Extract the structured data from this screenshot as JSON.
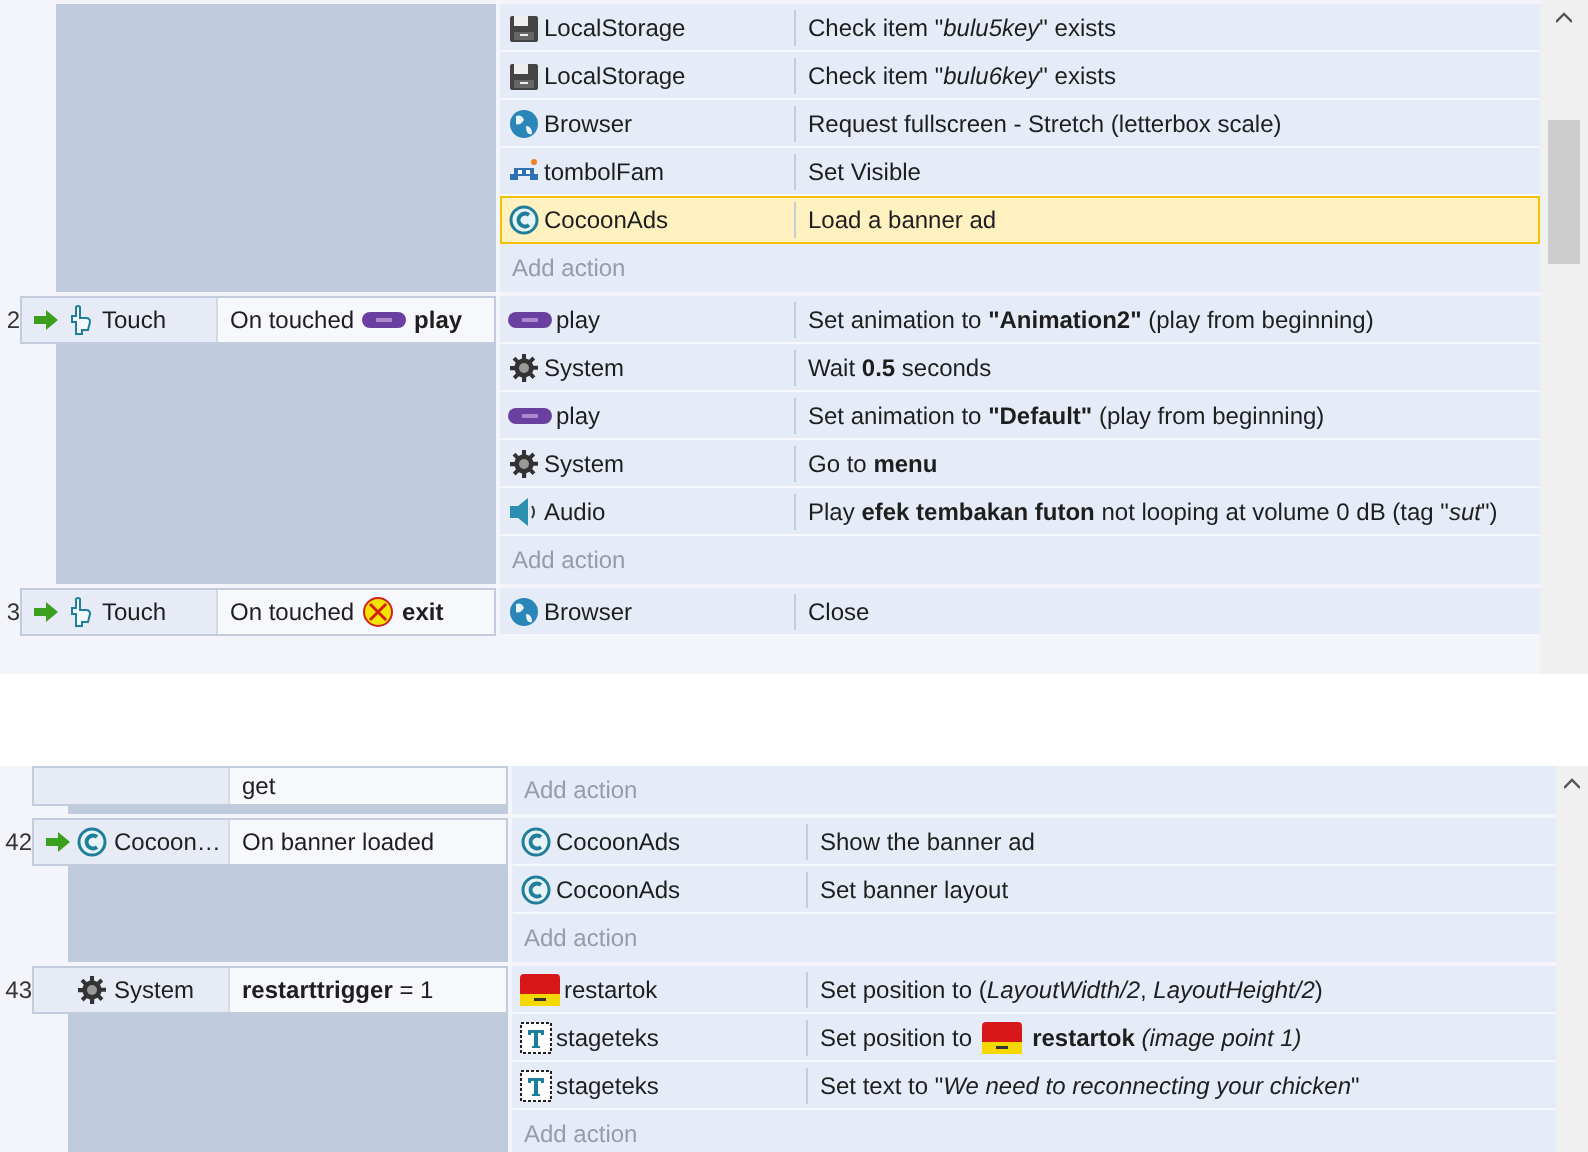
{
  "panes": [
    {
      "events": [
        {
          "actions": [
            {
              "kind": "localstorage",
              "object": "LocalStorage",
              "text": "Check item \"*bulu5key*\" exists",
              "selected": false
            },
            {
              "kind": "localstorage",
              "object": "LocalStorage",
              "text": "Check item \"*bulu6key*\" exists",
              "selected": false
            },
            {
              "kind": "browser",
              "object": "Browser",
              "text": "Request fullscreen - Stretch (letterbox scale)",
              "selected": false
            },
            {
              "kind": "sprite-invader",
              "object": "tombolFam",
              "text": "Set Visible",
              "selected": false
            },
            {
              "kind": "cocoon",
              "object": "CocoonAds",
              "text": "Load a banner ad",
              "selected": true
            }
          ],
          "add_action": "Add action"
        },
        {
          "number": "2",
          "condition": {
            "kind": "touch",
            "object": "Touch",
            "trigger": true,
            "text": "On touched",
            "param": {
              "kind": "sprite-bar",
              "name": "play"
            }
          },
          "actions": [
            {
              "kind": "sprite-bar",
              "object": "play",
              "text": "Set animation to **\"Animation2\"** (play from beginning)",
              "selected": false
            },
            {
              "kind": "system",
              "object": "System",
              "text": "Wait **0.5** seconds",
              "selected": false
            },
            {
              "kind": "sprite-bar",
              "object": "play",
              "text": "Set animation to **\"Default\"** (play from beginning)",
              "selected": false
            },
            {
              "kind": "system",
              "object": "System",
              "text": "Go to **menu**",
              "selected": false
            },
            {
              "kind": "audio",
              "object": "Audio",
              "text": "Play **efek tembakan futon** not looping at volume 0 dB (tag \"*sut*\")",
              "selected": false
            }
          ],
          "add_action": "Add action"
        },
        {
          "number": "3",
          "condition": {
            "kind": "touch",
            "object": "Touch",
            "trigger": true,
            "text": "On touched",
            "param": {
              "kind": "sprite-exit",
              "name": "exit"
            }
          },
          "actions": [
            {
              "kind": "browser",
              "object": "Browser",
              "text": "Close",
              "selected": false
            }
          ]
        }
      ]
    },
    {
      "events": [
        {
          "condition": {
            "text": "get"
          },
          "add_action": "Add action"
        },
        {
          "number": "42",
          "condition": {
            "kind": "cocoon",
            "object": "Cocoon…",
            "trigger": true,
            "text": "On banner loaded"
          },
          "actions": [
            {
              "kind": "cocoon",
              "object": "CocoonAds",
              "text": "Show the banner ad",
              "selected": false
            },
            {
              "kind": "cocoon",
              "object": "CocoonAds",
              "text": "Set banner layout",
              "selected": false
            }
          ],
          "add_action": "Add action"
        },
        {
          "number": "43",
          "condition": {
            "kind": "system",
            "object": "System",
            "trigger": false,
            "text": "**restarttrigger** = 1"
          },
          "actions": [
            {
              "kind": "sprite-red",
              "object": "restartok",
              "text": "Set position to (*LayoutWidth/2*, *LayoutHeight/2*)",
              "selected": false
            },
            {
              "kind": "text",
              "object": "stageteks",
              "text": "Set position to",
              "inline": {
                "kind": "sprite-red",
                "text": "**restartok** *(image point 1)*"
              },
              "selected": false
            },
            {
              "kind": "text",
              "object": "stageteks",
              "text": "Set text to \"*We need to reconnecting your chicken*\"",
              "selected": false
            }
          ],
          "add_action": "Add action"
        }
      ]
    }
  ]
}
